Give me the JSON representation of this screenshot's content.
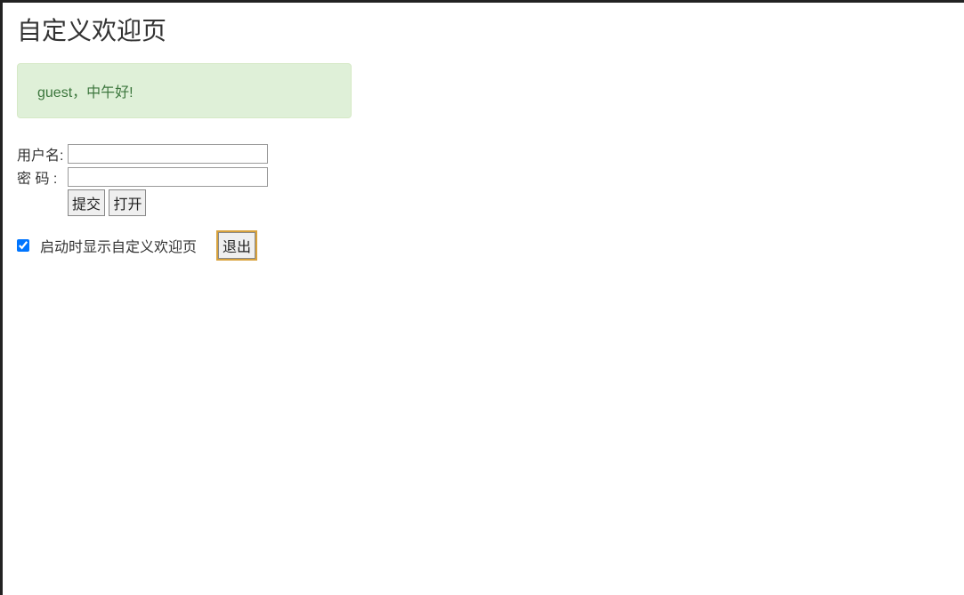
{
  "page": {
    "title": "自定义欢迎页"
  },
  "greeting": {
    "message": "guest，中午好!"
  },
  "form": {
    "username_label": "用户名:",
    "username_value": "",
    "password_label": "密 码 :",
    "password_value": "",
    "submit_label": "提交",
    "open_label": "打开"
  },
  "settings": {
    "show_welcome_checked": true,
    "show_welcome_label": "启动时显示自定义欢迎页",
    "exit_label": "退出"
  }
}
